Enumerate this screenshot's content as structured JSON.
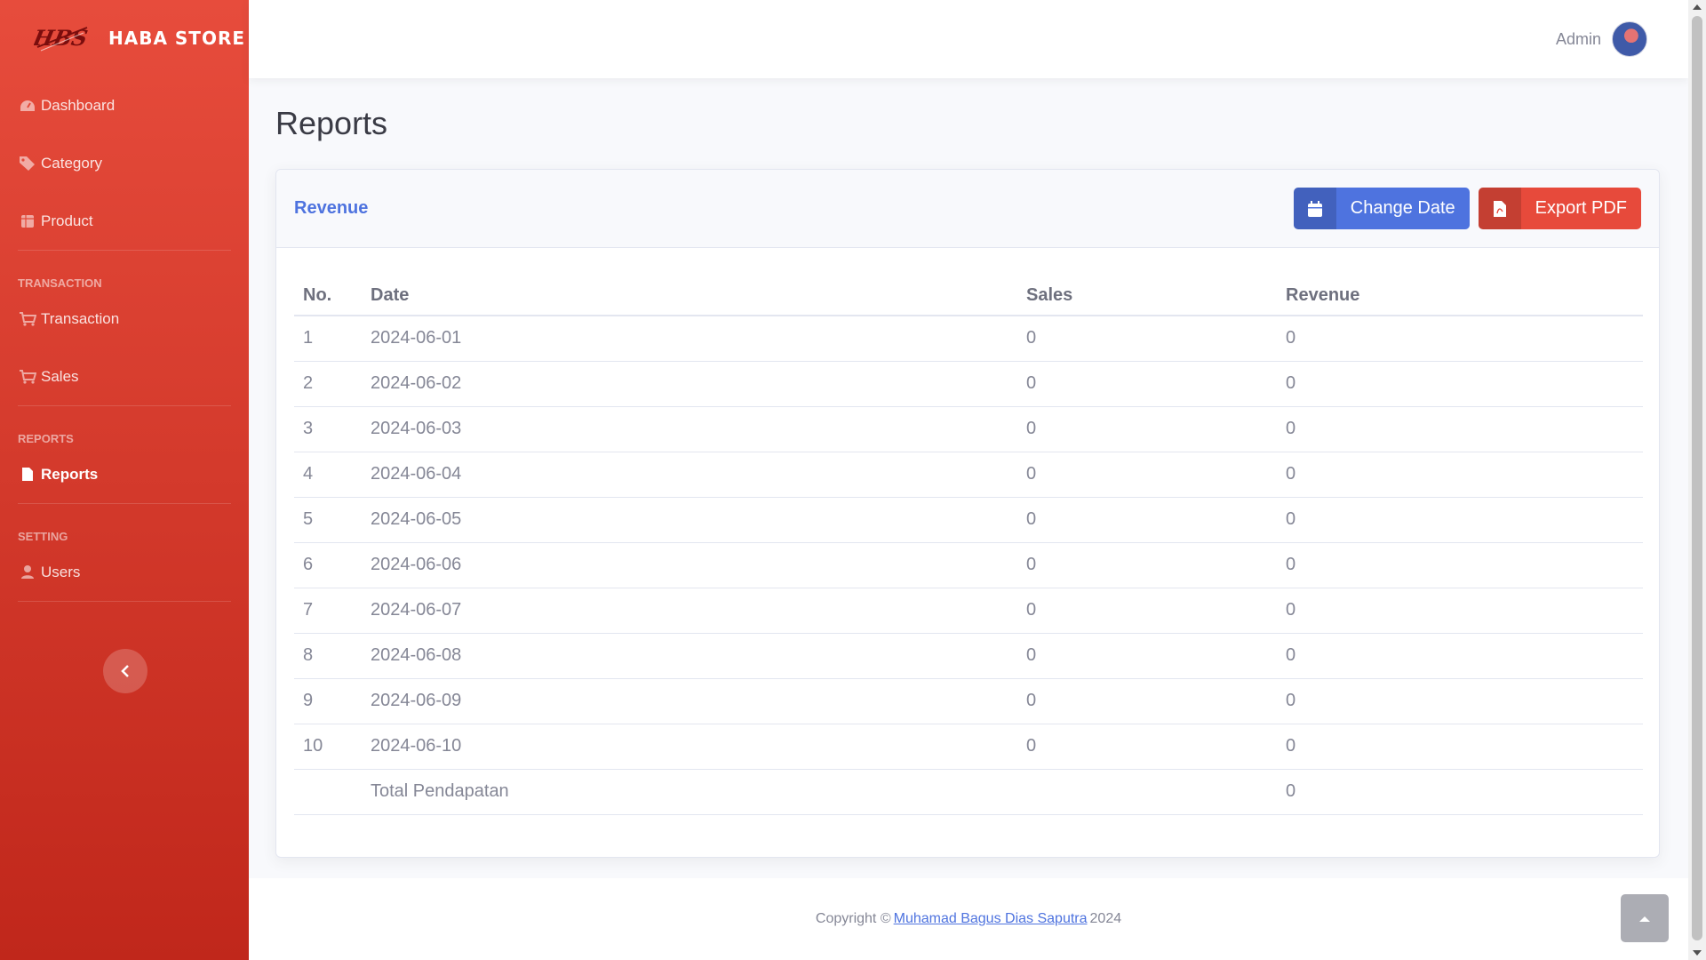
{
  "brand": {
    "name": "HABA STORE",
    "logo_text": "HBS"
  },
  "sidebar": {
    "items": [
      {
        "label": "Dashboard",
        "icon": "dashboard-icon"
      },
      {
        "label": "Category",
        "icon": "tags-icon"
      },
      {
        "label": "Product",
        "icon": "box-icon"
      }
    ],
    "transaction_heading": "TRANSACTION",
    "transaction_items": [
      {
        "label": "Transaction",
        "icon": "cart-icon"
      },
      {
        "label": "Sales",
        "icon": "cart-icon"
      }
    ],
    "reports_heading": "REPORTS",
    "reports_items": [
      {
        "label": "Reports",
        "icon": "file-icon",
        "active": true
      }
    ],
    "setting_heading": "SETTING",
    "setting_items": [
      {
        "label": "Users",
        "icon": "user-icon"
      }
    ]
  },
  "topbar": {
    "user_name": "Admin"
  },
  "page": {
    "title": "Reports"
  },
  "card": {
    "title": "Revenue",
    "change_date_label": "Change Date",
    "export_pdf_label": "Export PDF"
  },
  "table": {
    "headers": {
      "no": "No.",
      "date": "Date",
      "sales": "Sales",
      "revenue": "Revenue"
    },
    "rows": [
      {
        "no": "1",
        "date": "2024-06-01",
        "sales": "0",
        "revenue": "0"
      },
      {
        "no": "2",
        "date": "2024-06-02",
        "sales": "0",
        "revenue": "0"
      },
      {
        "no": "3",
        "date": "2024-06-03",
        "sales": "0",
        "revenue": "0"
      },
      {
        "no": "4",
        "date": "2024-06-04",
        "sales": "0",
        "revenue": "0"
      },
      {
        "no": "5",
        "date": "2024-06-05",
        "sales": "0",
        "revenue": "0"
      },
      {
        "no": "6",
        "date": "2024-06-06",
        "sales": "0",
        "revenue": "0"
      },
      {
        "no": "7",
        "date": "2024-06-07",
        "sales": "0",
        "revenue": "0"
      },
      {
        "no": "8",
        "date": "2024-06-08",
        "sales": "0",
        "revenue": "0"
      },
      {
        "no": "9",
        "date": "2024-06-09",
        "sales": "0",
        "revenue": "0"
      },
      {
        "no": "10",
        "date": "2024-06-10",
        "sales": "0",
        "revenue": "0"
      }
    ],
    "total": {
      "label": "Total Pendapatan",
      "revenue": "0"
    }
  },
  "footer": {
    "prefix": "Copyright ©",
    "author": "Muhamad Bagus Dias Saputra",
    "year": "2024"
  },
  "colors": {
    "sidebar_top": "#e74c3c",
    "sidebar_bottom": "#c0271b",
    "primary": "#4e73df",
    "danger": "#e74a3b"
  }
}
